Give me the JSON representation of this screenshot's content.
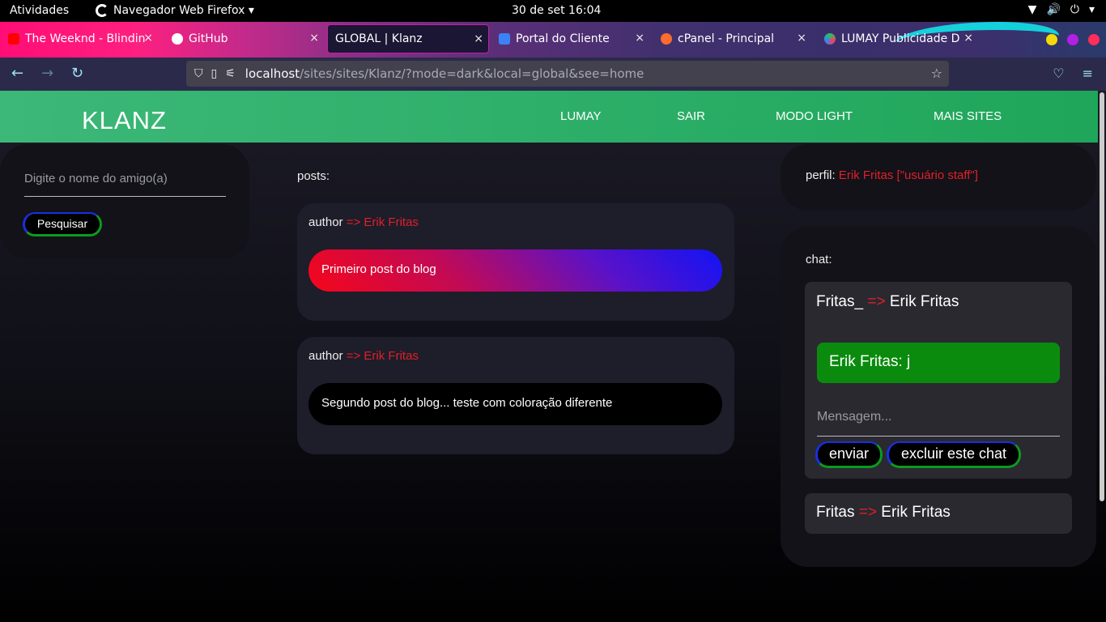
{
  "os_bar": {
    "activities": "Atividades",
    "app_name": "Navegador Web Firefox ▾",
    "clock": "30 de set  16:04",
    "tray": [
      "▼",
      "🔊",
      "⏻",
      "▾"
    ]
  },
  "tabs": [
    {
      "title": "The Weeknd - Blindin",
      "icon_color": "#ff0000"
    },
    {
      "title": "GitHub",
      "icon_color": "#ffffff"
    },
    {
      "title": "GLOBAL | Klanz",
      "icon_color": ""
    },
    {
      "title": "Portal do Cliente",
      "icon_color": "#3b82f6"
    },
    {
      "title": "cPanel - Principal",
      "icon_color": "#ff6c2c"
    },
    {
      "title": "LUMAY Publicidade D",
      "icon_color": "#22c55e"
    }
  ],
  "tab_close": "×",
  "window_dots": [
    "#f5d90a",
    "#b21fe6",
    "#ff2d5a"
  ],
  "toolbar": {
    "back": "←",
    "forward": "→",
    "reload": "↻",
    "url_host": "localhost",
    "url_path": "/sites/sites/Klanz/?mode=dark&local=global&see=home",
    "star": "☆",
    "pocket": "♡",
    "menu": "≡"
  },
  "site": {
    "logo": "KLANZ",
    "menu": [
      "LUMAY",
      "SAIR",
      "MODO LIGHT",
      "MAIS SITES"
    ]
  },
  "search": {
    "placeholder": "Digite o nome do amigo(a)",
    "button": "Pesquisar"
  },
  "posts": {
    "label": "posts:",
    "items": [
      {
        "author_label": "author",
        "arrow": "=>",
        "author": "Erik Fritas",
        "body": "Primeiro post do blog"
      },
      {
        "author_label": "author",
        "arrow": "=>",
        "author": "Erik Fritas",
        "body": "Segundo post do blog... teste com coloração diferente"
      }
    ]
  },
  "profile": {
    "label": "perfil:",
    "value": "Erik Fritas [\"usuário staff\"]"
  },
  "chat": {
    "label": "chat:",
    "threads": [
      {
        "from": "Fritas_",
        "arrow": "=>",
        "to": "Erik Fritas"
      },
      {
        "from": "Fritas",
        "arrow": "=>",
        "to": "Erik Fritas"
      }
    ],
    "message": "Erik Fritas: j",
    "input_placeholder": "Mensagem...",
    "send_button": "enviar",
    "delete_button": "excluir este chat"
  }
}
